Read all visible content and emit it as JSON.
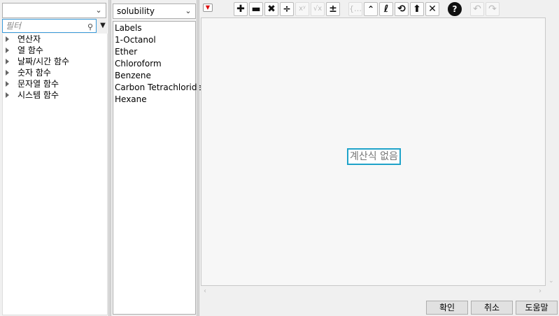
{
  "left_panel": {
    "group_select": "",
    "filter_placeholder": "필터",
    "functions": [
      "연산자",
      "열 함수",
      "날짜/시간 함수",
      "숫자 함수",
      "문자열 함수",
      "시스템 함수"
    ]
  },
  "column_panel": {
    "table_select": "solubility",
    "columns": [
      "Labels",
      "1-Octanol",
      "Ether",
      "Chloroform",
      "Benzene",
      "Carbon Tetrachloride",
      "Hexane"
    ]
  },
  "formula": {
    "placeholder": "계산식 없음"
  },
  "toolbar": {
    "icons": [
      "menu-icon",
      "plus-icon",
      "minus-icon",
      "multiply-icon",
      "divide-icon",
      "power-icon",
      "root-icon",
      "plus-minus-icon",
      "list-icon",
      "caret-icon",
      "local-icon",
      "swap-icon",
      "peel-icon",
      "delete-icon",
      "help-icon",
      "undo-icon",
      "redo-icon"
    ]
  },
  "buttons": {
    "ok": "확인",
    "cancel": "취소",
    "help": "도움말"
  },
  "colors": {
    "accent": "#1fa3c9",
    "filter_border": "#3a9ad9"
  }
}
